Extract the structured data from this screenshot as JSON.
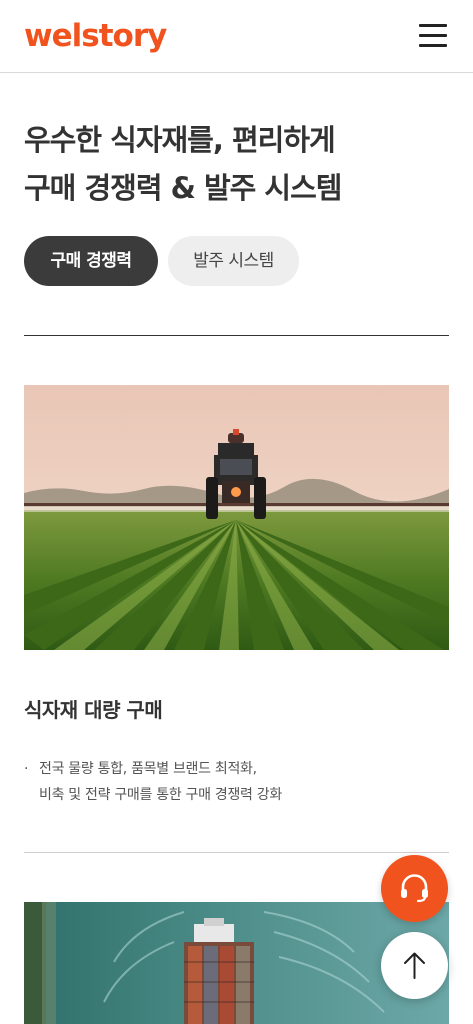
{
  "header": {
    "logo_text": "welstory",
    "menu_icon": "hamburger-menu-icon"
  },
  "hero": {
    "title_line1": "우수한 식자재를, 편리하게",
    "title_line2": "구매 경쟁력 & 발주 시스템"
  },
  "tabs": [
    {
      "label": "구매 경쟁력",
      "active": true
    },
    {
      "label": "발주 시스템",
      "active": false
    }
  ],
  "cards": [
    {
      "title": "식자재 대량 구매",
      "bullet": "·",
      "desc_line1": "전국 물량 통합, 품목별 브랜드 최적화,",
      "desc_line2": "비축 및 전략 구매를 통한 구매 경쟁력 강화"
    }
  ],
  "floating": {
    "chat_icon": "headset-icon",
    "top_icon": "arrow-up-icon"
  },
  "colors": {
    "brand": "#f1531f",
    "tab_active_bg": "#3b3b3b",
    "tab_inactive_bg": "#eeeeee",
    "text": "#333333"
  }
}
